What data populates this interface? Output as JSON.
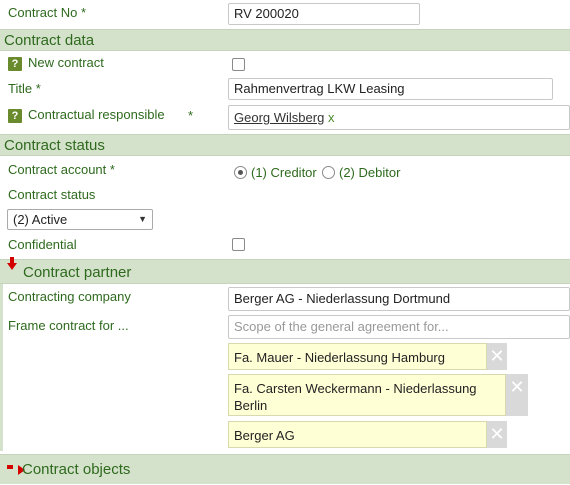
{
  "header": {
    "contract_no_label": "Contract No *",
    "contract_no_value": "RV 200020"
  },
  "contract_data": {
    "section_title": "Contract data",
    "new_contract_label": "New contract",
    "title_label": "Title *",
    "title_value": "Rahmenvertrag LKW Leasing",
    "responsible_label": "Contractual responsible",
    "responsible_required": "*",
    "responsible_value": "Georg Wilsberg",
    "responsible_remove": "x",
    "help_glyph": "?"
  },
  "contract_status": {
    "section_title": "Contract status",
    "account_label": "Contract account *",
    "account_options": [
      "(1) Creditor",
      "(2) Debitor"
    ],
    "account_selected": "(1) Creditor",
    "status_label": "Contract status",
    "status_value": "(2) Active",
    "confidential_label": "Confidential"
  },
  "contract_partner": {
    "section_title": "Contract partner",
    "company_label": "Contracting company",
    "company_value": "Berger AG - Niederlassung Dortmund",
    "frame_label": "Frame contract for ...",
    "frame_placeholder": "Scope of the general agreement for...",
    "frame_items": [
      "Fa. Mauer - Niederlassung Hamburg",
      "Fa. Carsten Weckermann - Niederlassung Berlin",
      "Berger AG"
    ],
    "remove_glyph": "✕"
  },
  "contract_objects": {
    "section_title": "Contract objects"
  }
}
